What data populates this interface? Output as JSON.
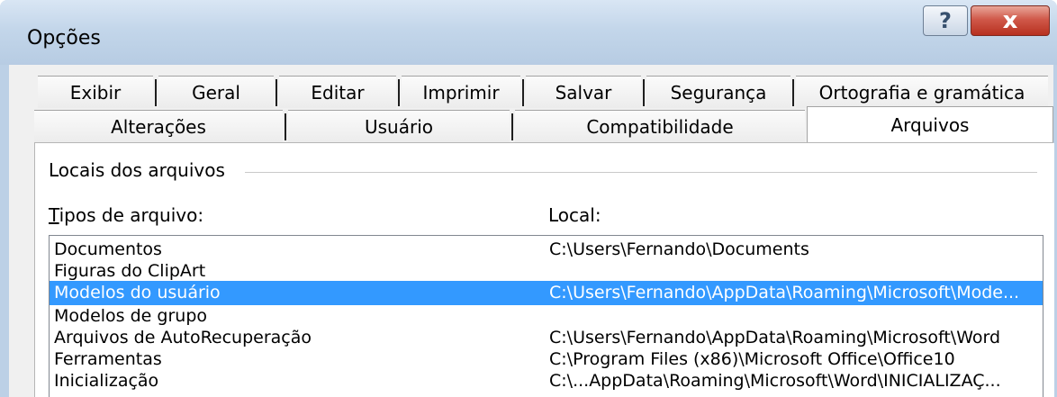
{
  "window": {
    "title": "Opções",
    "help_label": "?",
    "close_label": "x"
  },
  "tabs": {
    "row1": [
      "Exibir",
      "Geral",
      "Editar",
      "Imprimir",
      "Salvar",
      "Segurança",
      "Ortografia e gramática"
    ],
    "row2": [
      "Alterações",
      "Usuário",
      "Compatibilidade",
      "Arquivos"
    ],
    "active": "Arquivos"
  },
  "group": {
    "label": "Locais dos arquivos"
  },
  "table": {
    "headers": {
      "type_first_letter": "T",
      "type_rest": "ipos de arquivo:",
      "location": "Local:"
    },
    "rows": [
      {
        "type": "Documentos",
        "location": "C:\\Users\\Fernando\\Documents",
        "selected": false
      },
      {
        "type": "Figuras do ClipArt",
        "location": "",
        "selected": false
      },
      {
        "type": "Modelos do usuário",
        "location": "C:\\Users\\Fernando\\AppData\\Roaming\\Microsoft\\Mode...",
        "selected": true
      },
      {
        "type": "Modelos de grupo",
        "location": "",
        "selected": false
      },
      {
        "type": "Arquivos de AutoRecuperação",
        "location": "C:\\Users\\Fernando\\AppData\\Roaming\\Microsoft\\Word",
        "selected": false
      },
      {
        "type": "Ferramentas",
        "location": "C:\\Program Files (x86)\\Microsoft Office\\Office10",
        "selected": false
      },
      {
        "type": "Inicialização",
        "location": "C:\\...AppData\\Roaming\\Microsoft\\Word\\INICIALIZAÇ...",
        "selected": false
      }
    ]
  },
  "colors": {
    "selection": "#3399ff",
    "titlebar": "#c3d6ea",
    "close_button": "#c7412f"
  }
}
